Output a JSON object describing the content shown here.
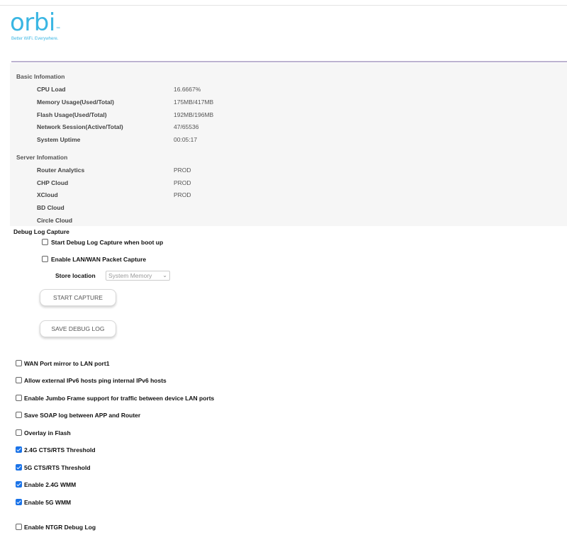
{
  "logo": {
    "word": "orbi",
    "tm": "™",
    "tagline": "Better WiFi. Everywhere."
  },
  "basic": {
    "title": "Basic Infomation",
    "rows": [
      {
        "label": "CPU Load",
        "value": "16.6667%"
      },
      {
        "label": "Memory Usage(Used/Total)",
        "value": "175MB/417MB"
      },
      {
        "label": "Flash Usage(Used/Total)",
        "value": "192MB/196MB"
      },
      {
        "label": "Network Session(Active/Total)",
        "value": "47/65536"
      },
      {
        "label": "System Uptime",
        "value": "00:05:17"
      }
    ]
  },
  "server": {
    "title": "Server Infomation",
    "rows": [
      {
        "label": "Router Analytics",
        "value": "PROD"
      },
      {
        "label": "CHP Cloud",
        "value": "PROD"
      },
      {
        "label": "XCloud",
        "value": "PROD"
      },
      {
        "label": "BD Cloud",
        "value": ""
      },
      {
        "label": "Circle Cloud",
        "value": ""
      }
    ]
  },
  "debug": {
    "title": "Debug Log Capture",
    "start_on_boot": {
      "label": "Start Debug Log Capture when boot up",
      "checked": false
    },
    "packet_capture": {
      "label": "Enable LAN/WAN Packet Capture",
      "checked": false
    },
    "store_location_label": "Store location",
    "store_location_value": "System Memory",
    "start_button": "START CAPTURE",
    "save_button": "SAVE DEBUG LOG"
  },
  "options": [
    {
      "label": "WAN Port mirror to LAN port1",
      "checked": false
    },
    {
      "label": "Allow external IPv6 hosts ping internal IPv6 hosts",
      "checked": false
    },
    {
      "label": "Enable Jumbo Frame support for traffic between device LAN ports",
      "checked": false
    },
    {
      "label": "Save SOAP log between APP and Router",
      "checked": false
    },
    {
      "label": "Overlay in Flash",
      "checked": false
    },
    {
      "label": "2.4G CTS/RTS Threshold",
      "checked": true
    },
    {
      "label": "5G CTS/RTS Threshold",
      "checked": true
    },
    {
      "label": "Enable 2.4G WMM",
      "checked": true
    },
    {
      "label": "Enable 5G WMM",
      "checked": true
    },
    {
      "label": "Enable NTGR Debug Log",
      "checked": false
    }
  ],
  "colors": {
    "brand": "#3ab6e3",
    "accent": "#1a73e8",
    "rule": "#bcb2d0"
  }
}
